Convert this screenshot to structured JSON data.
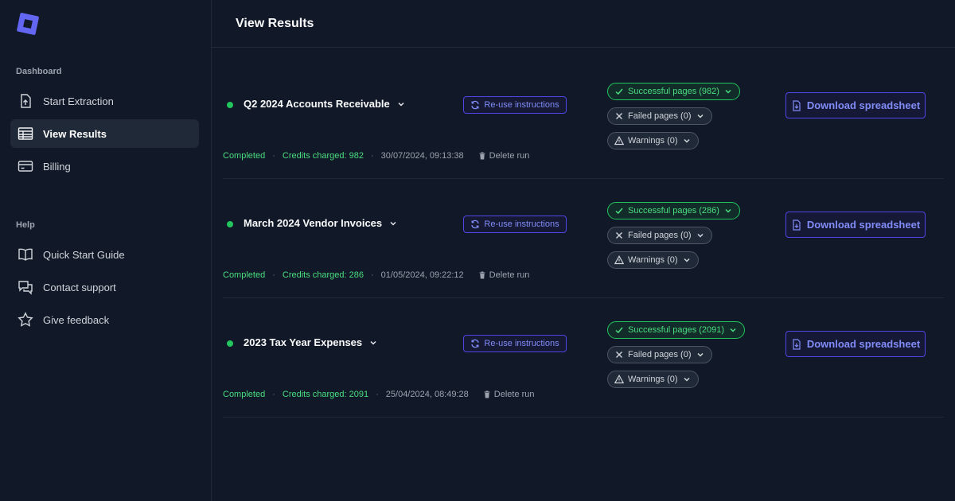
{
  "sidebar": {
    "dashboard_label": "Dashboard",
    "help_label": "Help",
    "items": [
      {
        "label": "Start Extraction",
        "icon": "upload-file-icon"
      },
      {
        "label": "View Results",
        "icon": "table-icon"
      },
      {
        "label": "Billing",
        "icon": "credit-card-icon"
      },
      {
        "label": "Quick Start Guide",
        "icon": "book-icon"
      },
      {
        "label": "Contact support",
        "icon": "chat-bubbles-icon"
      },
      {
        "label": "Give feedback",
        "icon": "star-icon"
      }
    ]
  },
  "header": {
    "title": "View Results"
  },
  "runs": [
    {
      "title": "Q2 2024 Accounts Receivable",
      "reuse_label": "Re-use instructions",
      "success_label": "Successful pages (982)",
      "failed_label": "Failed pages (0)",
      "warnings_label": "Warnings (0)",
      "download_label": "Download spreadsheet",
      "status": "Completed",
      "credits": "Credits charged: 982",
      "timestamp": "30/07/2024, 09:13:38",
      "delete_label": "Delete run"
    },
    {
      "title": "March 2024 Vendor Invoices",
      "reuse_label": "Re-use instructions",
      "success_label": "Successful pages (286)",
      "failed_label": "Failed pages (0)",
      "warnings_label": "Warnings (0)",
      "download_label": "Download spreadsheet",
      "status": "Completed",
      "credits": "Credits charged: 286",
      "timestamp": "01/05/2024, 09:22:12",
      "delete_label": "Delete run"
    },
    {
      "title": "2023 Tax Year Expenses",
      "reuse_label": "Re-use instructions",
      "success_label": "Successful pages (2091)",
      "failed_label": "Failed pages (0)",
      "warnings_label": "Warnings (0)",
      "download_label": "Download spreadsheet",
      "status": "Completed",
      "credits": "Credits charged: 2091",
      "timestamp": "25/04/2024, 08:49:28",
      "delete_label": "Delete run"
    }
  ],
  "colors": {
    "background": "#111827",
    "accent": "#818cf8",
    "success": "#4ade80",
    "logo": "#6366f1"
  }
}
